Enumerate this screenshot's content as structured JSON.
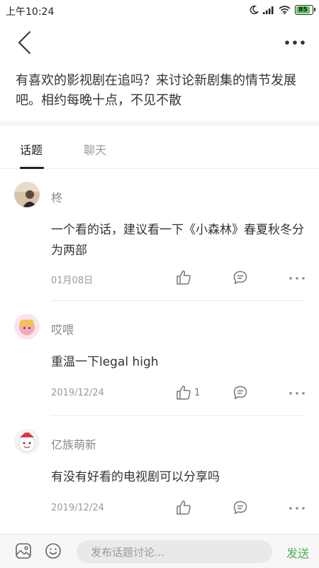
{
  "status": {
    "time": "上午10:24",
    "battery": "85"
  },
  "description": "有喜欢的影视剧在追吗？来讨论新剧集的情节发展吧。相约每晚十点，不见不散",
  "tabs": [
    {
      "label": "话题"
    },
    {
      "label": "聊天"
    }
  ],
  "posts": [
    {
      "author": "柊",
      "content": "一个看的话，建议看一下《小森林》春夏秋冬分为两部",
      "date": "01月08日",
      "likes": ""
    },
    {
      "author": "哎喂",
      "content": "重温一下legal high",
      "date": "2019/12/24",
      "likes": "1"
    },
    {
      "author": "亿族萌新",
      "content": "有没有好看的电视剧可以分享吗",
      "date": "2019/12/24",
      "likes": ""
    }
  ],
  "composer": {
    "placeholder": "发布话题讨论...",
    "send_label": "发送"
  },
  "colors": {
    "accent": "#4caf50",
    "battery": "#5cc65c"
  }
}
